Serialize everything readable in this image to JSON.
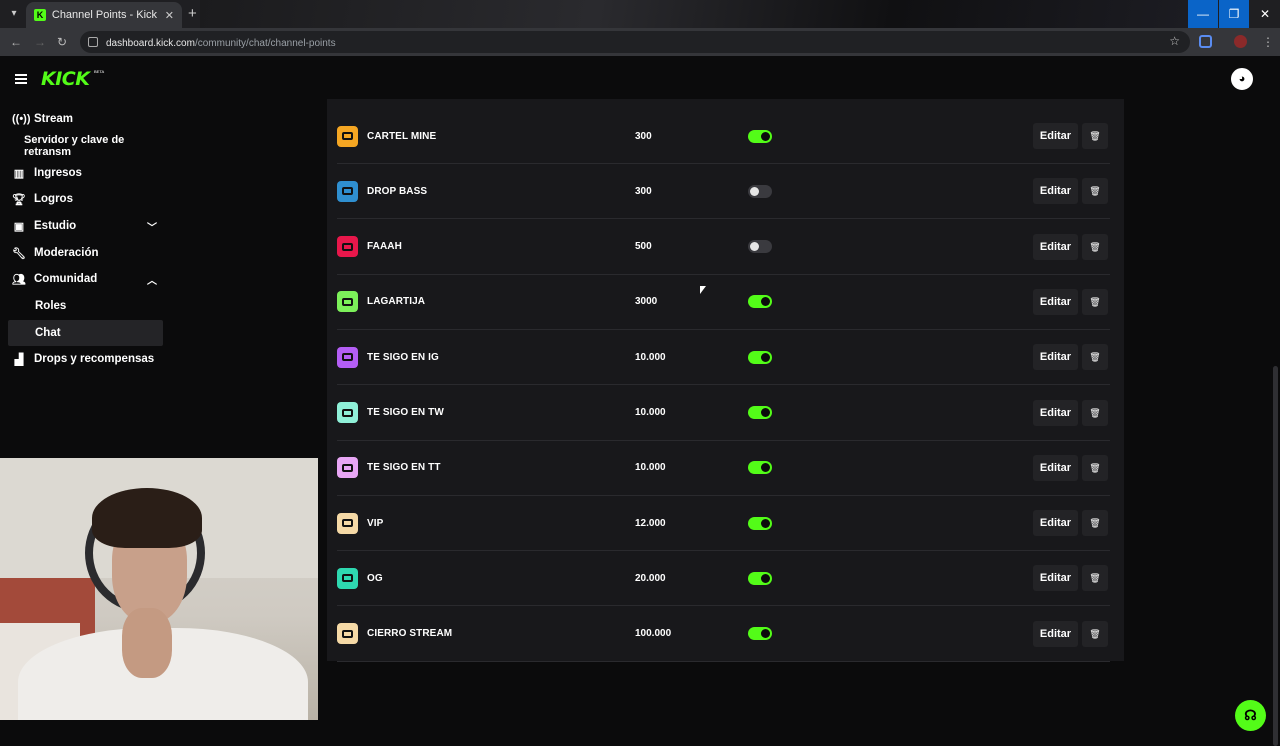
{
  "browser": {
    "tab_title": "Channel Points - Kick Dashboard",
    "favicon_letter": "K",
    "url_host": "dashboard.kick.com",
    "url_path": "/community/chat/channel-points"
  },
  "header": {
    "logo": "KICK",
    "logo_badge": "BETA"
  },
  "sidebar": {
    "items": [
      {
        "label": "Stream",
        "icon": "broadcast-icon"
      },
      {
        "label": "Servidor y clave de retransm"
      },
      {
        "label": "Ingresos",
        "icon": "chart-icon"
      },
      {
        "label": "Logros",
        "icon": "trophy-icon"
      },
      {
        "label": "Estudio",
        "icon": "studio-icon"
      },
      {
        "label": "Moderación",
        "icon": "wrench-icon"
      },
      {
        "label": "Comunidad",
        "icon": "people-icon"
      },
      {
        "label": "Roles"
      },
      {
        "label": "Chat"
      },
      {
        "label": "Drops y recompensas",
        "icon": "gift-icon"
      }
    ]
  },
  "rewards": [
    {
      "name": "CARTEL MINE",
      "cost": "300",
      "enabled": true,
      "color": "#f5a623"
    },
    {
      "name": "DROP BASS",
      "cost": "300",
      "enabled": false,
      "color": "#2f8fd0"
    },
    {
      "name": "FAAAH",
      "cost": "500",
      "enabled": false,
      "color": "#e8174b"
    },
    {
      "name": "LAGARTIJA",
      "cost": "3000",
      "enabled": true,
      "color": "#7cf05a"
    },
    {
      "name": "TE SIGO EN IG",
      "cost": "10.000",
      "enabled": true,
      "color": "#b45ef5"
    },
    {
      "name": "TE SIGO EN TW",
      "cost": "10.000",
      "enabled": true,
      "color": "#8ff0d8"
    },
    {
      "name": "TE SIGO EN TT",
      "cost": "10.000",
      "enabled": true,
      "color": "#e8a6f5"
    },
    {
      "name": "VIP",
      "cost": "12.000",
      "enabled": true,
      "color": "#f5d9a6"
    },
    {
      "name": "OG",
      "cost": "20.000",
      "enabled": true,
      "color": "#2ed8b0"
    },
    {
      "name": "CIERRO STREAM",
      "cost": "100.000",
      "enabled": true,
      "color": "#f5d9a6"
    }
  ],
  "actions": {
    "edit_label": "Editar"
  },
  "colors": {
    "accent": "#53fc18",
    "panel": "#18181b",
    "background": "#0b0b0c"
  }
}
